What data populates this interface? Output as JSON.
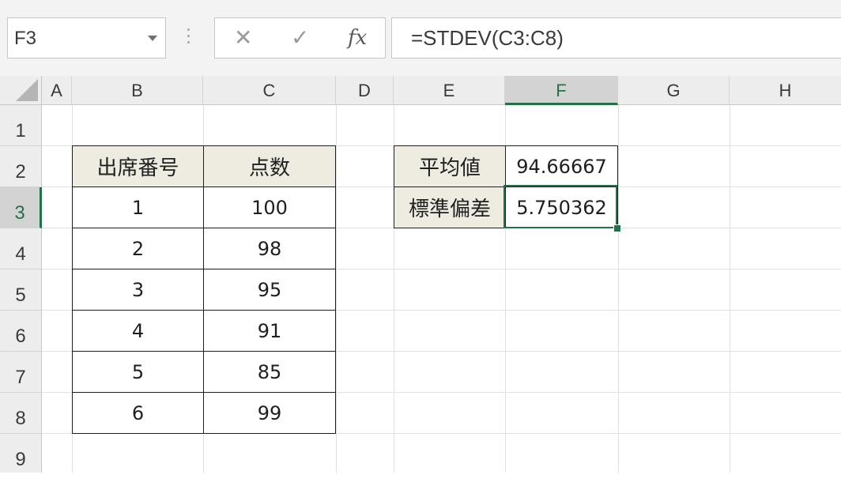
{
  "formula_bar": {
    "name_box": "F3",
    "cancel_icon": "✕",
    "enter_icon": "✓",
    "fx_label": "fx",
    "formula": "=STDEV(C3:C8)"
  },
  "columns": [
    "A",
    "B",
    "C",
    "D",
    "E",
    "F",
    "G",
    "H"
  ],
  "rows": [
    "1",
    "2",
    "3",
    "4",
    "5",
    "6",
    "7",
    "8",
    "9"
  ],
  "selected": {
    "column": "F",
    "row": "3"
  },
  "table": {
    "headers": [
      "出席番号",
      "点数"
    ],
    "rows": [
      [
        "1",
        "100"
      ],
      [
        "2",
        "98"
      ],
      [
        "3",
        "95"
      ],
      [
        "4",
        "91"
      ],
      [
        "5",
        "85"
      ],
      [
        "6",
        "99"
      ]
    ]
  },
  "stats": {
    "mean_label": "平均値",
    "mean_value": "94.66667",
    "stdev_label": "標準偏差",
    "stdev_value": "5.750362"
  },
  "colors": {
    "accent": "#217346",
    "header_fill": "#eeece1"
  }
}
